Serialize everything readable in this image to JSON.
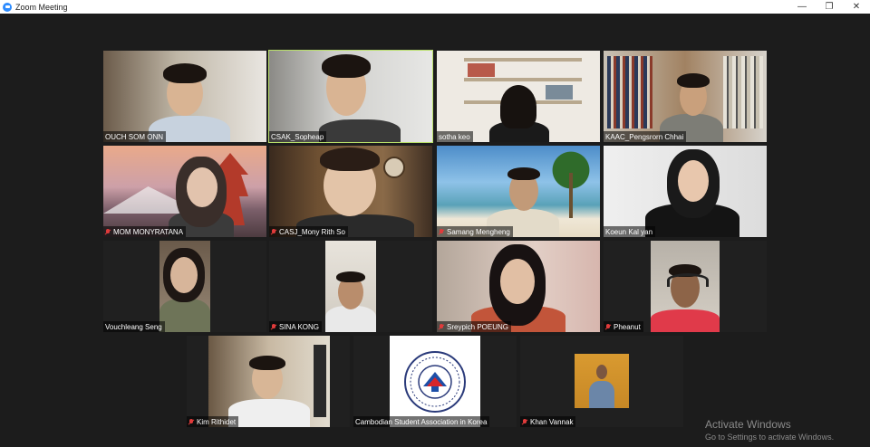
{
  "window": {
    "title": "Zoom Meeting",
    "minimize": "—",
    "restore": "❐",
    "close": "✕"
  },
  "participants": [
    {
      "name": "OUCH SOM ONN",
      "muted": false
    },
    {
      "name": "CSAK_Sopheap",
      "muted": false
    },
    {
      "name": "sotha keo",
      "muted": false
    },
    {
      "name": "KAAC_Pengsrorn Chhai",
      "muted": false
    },
    {
      "name": "MOM MONYRATANA",
      "muted": true
    },
    {
      "name": "CASJ_Mony Rith So",
      "muted": true
    },
    {
      "name": "Samang Mengheng",
      "muted": true
    },
    {
      "name": "Koeun Kal yan",
      "muted": false
    },
    {
      "name": "Vouchleang Seng",
      "muted": false
    },
    {
      "name": "SINA KONG",
      "muted": true
    },
    {
      "name": "Sreypich POEUNG",
      "muted": true
    },
    {
      "name": "Pheanut",
      "muted": true
    },
    {
      "name": "Kim Rithidet",
      "muted": true
    },
    {
      "name": "Cambodian Student Association in Korea",
      "muted": false
    },
    {
      "name": "Khan Vannak",
      "muted": true
    }
  ],
  "watermark": {
    "title": "Activate Windows",
    "subtitle": "Go to Settings to activate Windows."
  },
  "colors": {
    "active_speaker_border": "#b9e06a",
    "mic_muted": "#e03b3b",
    "zoom_blue": "#2d8cff"
  }
}
